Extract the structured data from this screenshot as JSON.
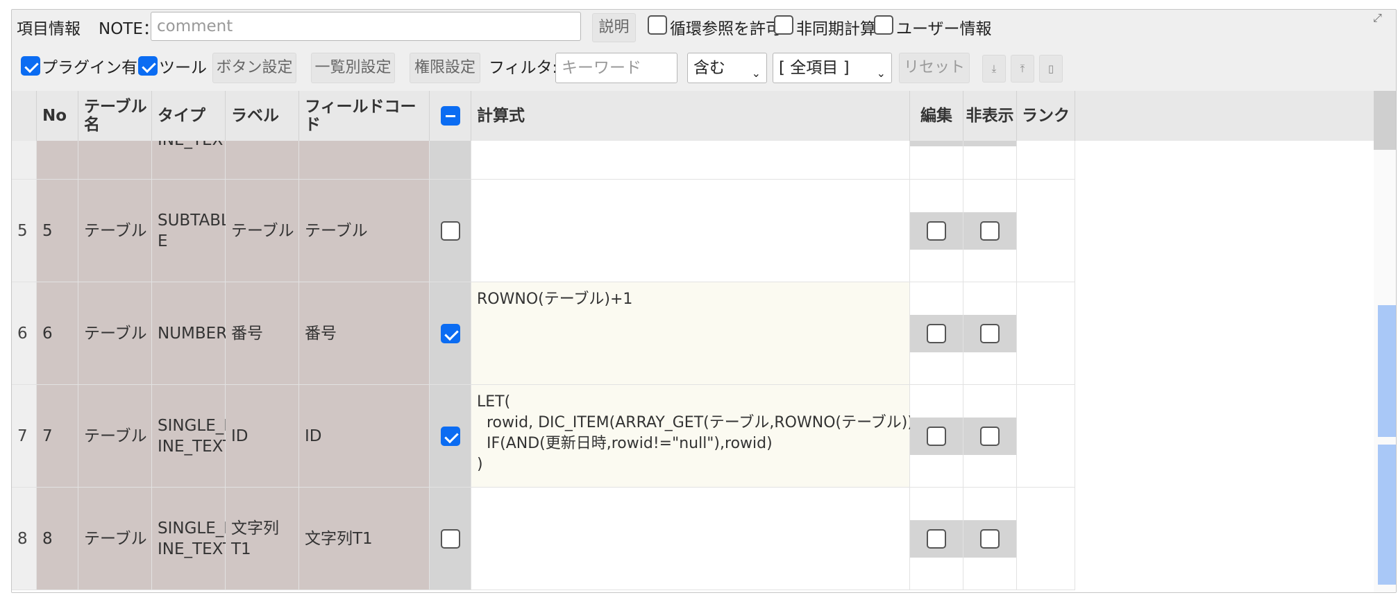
{
  "toolbar": {
    "item_info": "項目情報",
    "note_label": "NOTE：",
    "note_placeholder": "comment",
    "explain_button": "説明",
    "allow_circular": "循環参照を許可",
    "async_calc": "非同期計算",
    "user_info": "ユーザー情報",
    "plugin_enabled": "プラグイン有効",
    "tools": "ツール",
    "button_settings": "ボタン設定",
    "list_settings": "一覧別設定",
    "permission_settings": "権限設定",
    "filter_label": "フィルタ:",
    "keyword_placeholder": "キーワード",
    "match_select": "含む",
    "field_select": "[ 全項目 ]",
    "reset_button": "リセット",
    "download_icon": "⤓",
    "upload_icon": "⤒",
    "clipboard_icon": "▯"
  },
  "table": {
    "headers": {
      "no": "No",
      "table_name": "テーブル名",
      "type": "タイプ",
      "label": "ラベル",
      "field_code": "フィールドコード",
      "formula": "計算式",
      "edit": "編集",
      "hidden": "非表示",
      "rank": "ランク"
    },
    "partial_row": {
      "type": "INE_TEXT"
    },
    "rows": [
      {
        "idx": "5",
        "no": "5",
        "table": "テーブル",
        "type": "SUBTABL\nE",
        "label": "テーブル",
        "code": "テーブル",
        "checked": false,
        "formula": ""
      },
      {
        "idx": "6",
        "no": "6",
        "table": "テーブル",
        "type": "NUMBER",
        "label": "番号",
        "code": "番号",
        "checked": true,
        "formula": "ROWNO(テーブル)+1"
      },
      {
        "idx": "7",
        "no": "7",
        "table": "テーブル",
        "type": "SINGLE_L\nINE_TEXT",
        "label": "ID",
        "code": "ID",
        "checked": true,
        "formula": "LET(\n  rowid, DIC_ITEM(ARRAY_GET(テーブル,ROWNO(テーブル)),\"id\"),\n  IF(AND(更新日時,rowid!=\"null\"),rowid)\n)"
      },
      {
        "idx": "8",
        "no": "8",
        "table": "テーブル",
        "type": "SINGLE_L\nINE_TEXT",
        "label": "文字列T1",
        "code": "文字列T1",
        "checked": false,
        "formula": ""
      }
    ]
  },
  "colors": {
    "accent": "#0b6cf2",
    "readonly_cell": "#d0c6c4",
    "highlight_row": "#fbfaf1",
    "scroll_marker": "#a9c8f7"
  }
}
